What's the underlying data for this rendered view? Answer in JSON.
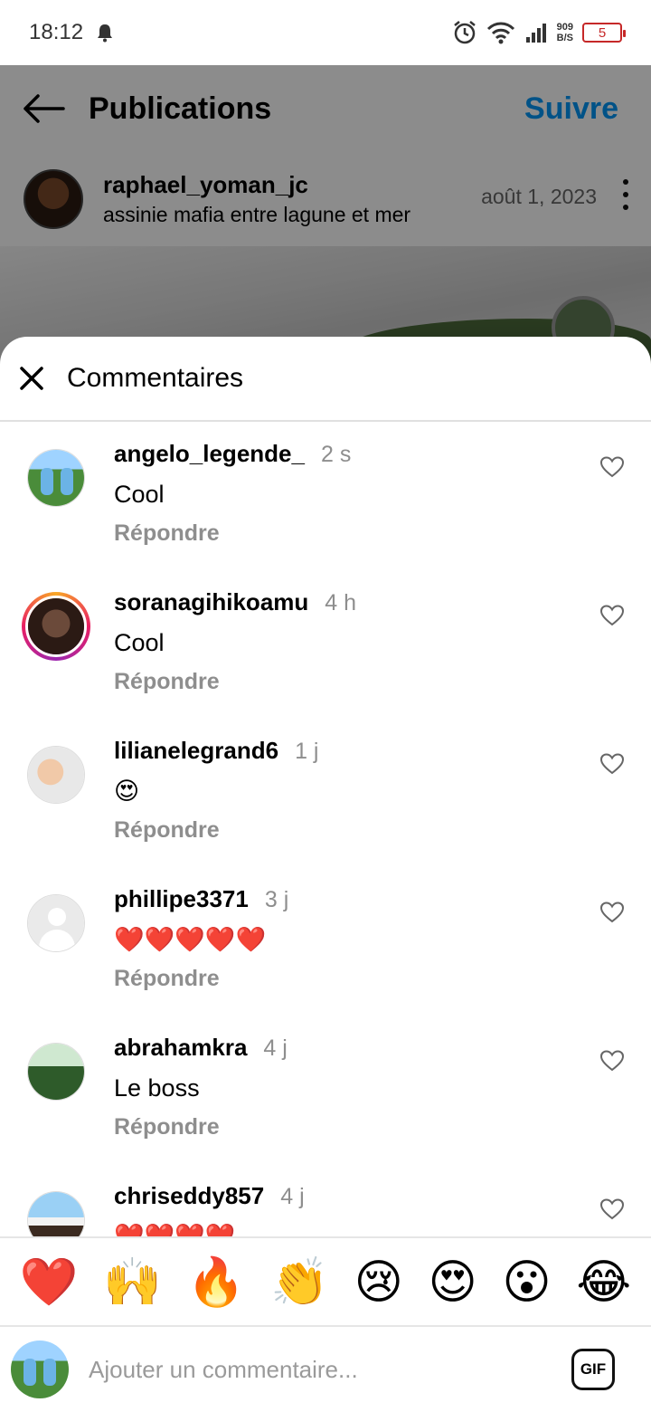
{
  "status_bar": {
    "time": "18:12",
    "net_speed_value": "909",
    "net_speed_unit": "B/S",
    "battery": "5"
  },
  "post": {
    "title": "Publications",
    "follow_label": "Suivre",
    "author": "raphael_yoman_jc",
    "location": "assinie mafia entre lagune et mer",
    "date": "août 1, 2023"
  },
  "comments_sheet": {
    "title": "Commentaires",
    "reply_label": "Répondre",
    "comments": [
      {
        "user": "angelo_legende_",
        "time": "2 s",
        "text": "Cool"
      },
      {
        "user": "soranagihikoamu",
        "time": "4 h",
        "text": "Cool"
      },
      {
        "user": "lilianelegrand6",
        "time": "1 j",
        "text": "😍"
      },
      {
        "user": "phillipe3371",
        "time": "3 j",
        "text": "❤️❤️❤️❤️❤️"
      },
      {
        "user": "abrahamkra",
        "time": "4 j",
        "text": "Le boss"
      },
      {
        "user": "chriseddy857",
        "time": "4 j",
        "text": "❤️❤️❤️❤️"
      }
    ]
  },
  "emoji_bar": [
    "❤️",
    "🙌",
    "🔥",
    "👏",
    "😢",
    "😍",
    "😮",
    "😂"
  ],
  "input": {
    "placeholder": "Ajouter un commentaire...",
    "gif_label": "GIF"
  },
  "colors": {
    "accent": "#0095f6",
    "battery_low": "#c62828",
    "muted_text": "#8e8e8e"
  }
}
